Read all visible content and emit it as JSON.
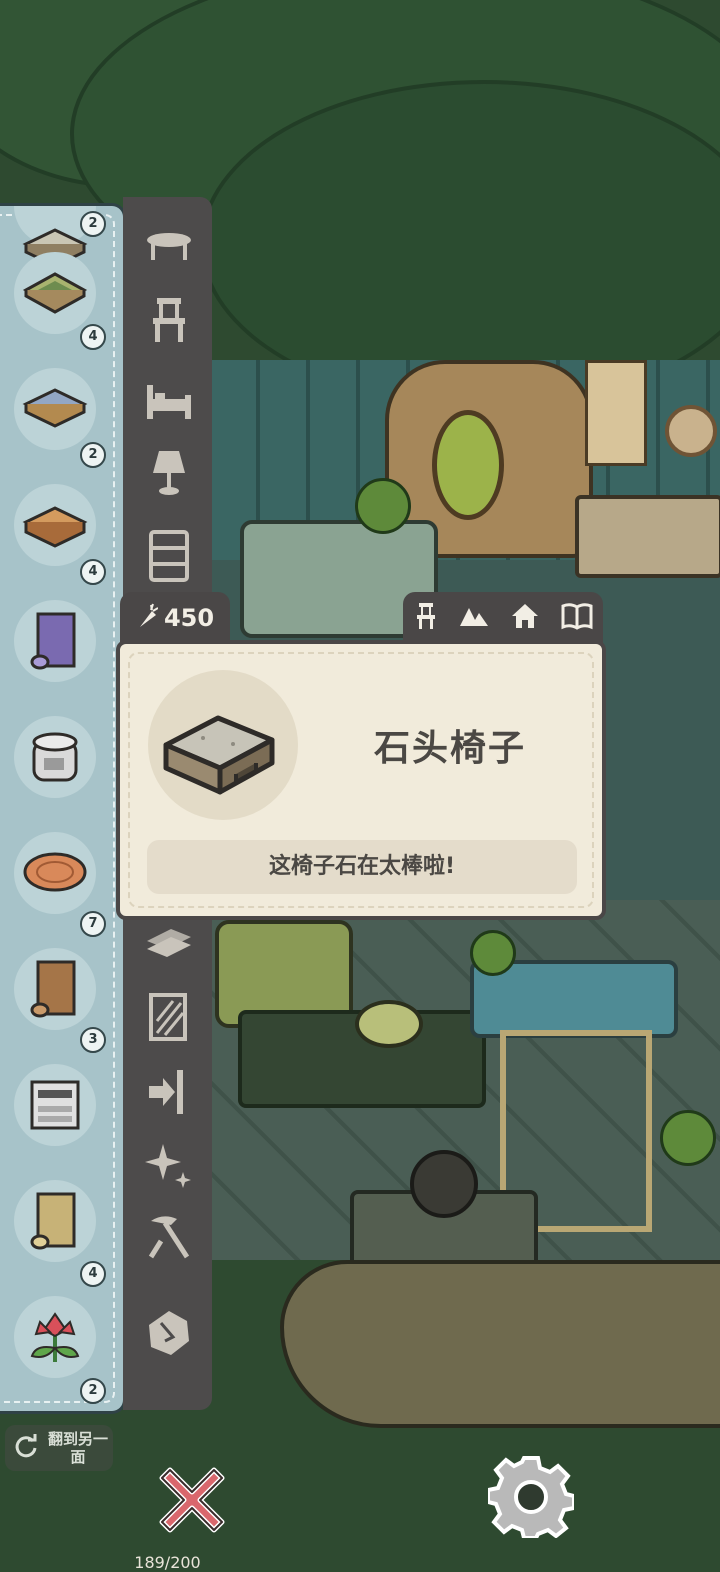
{
  "inventory": {
    "items": [
      {
        "name": "stone-table",
        "count": "2"
      },
      {
        "name": "green-mat-table",
        "count": "4"
      },
      {
        "name": "blue-plank-bench",
        "count": "2"
      },
      {
        "name": "wooden-crate",
        "count": "4"
      },
      {
        "name": "purple-wallpaper-roll",
        "count": ""
      },
      {
        "name": "rice-cooker",
        "count": ""
      },
      {
        "name": "wood-slice-rug",
        "count": "7"
      },
      {
        "name": "wood-wallpaper-roll",
        "count": "3"
      },
      {
        "name": "printer-copier",
        "count": ""
      },
      {
        "name": "bamboo-wallpaper-roll",
        "count": "4"
      },
      {
        "name": "red-flower-plant",
        "count": "2"
      }
    ]
  },
  "categories": [
    "table-icon",
    "chair-icon",
    "bed-icon",
    "lamp-icon",
    "shelf-icon",
    "floor-icon",
    "wallpaper-icon",
    "door-icon",
    "sparkle-icon",
    "tools-icon",
    "stone-icon"
  ],
  "capacity": "189/200",
  "currency": {
    "value": "450",
    "icon": "carrot-icon"
  },
  "tags": [
    "chair-icon",
    "mountain-icon",
    "home-icon",
    "book-icon"
  ],
  "item": {
    "name": "石头椅子",
    "description": "这椅子石在太棒啦!"
  },
  "controls": {
    "flip_label": "翻到另一面",
    "close_icon": "close-icon",
    "settings_icon": "gear-icon"
  },
  "colors": {
    "inventory_bg": "#a7c3c9",
    "category_bar": "#4d4b4b",
    "card_bg": "#f1ebdb",
    "close_red": "#d9676d"
  }
}
